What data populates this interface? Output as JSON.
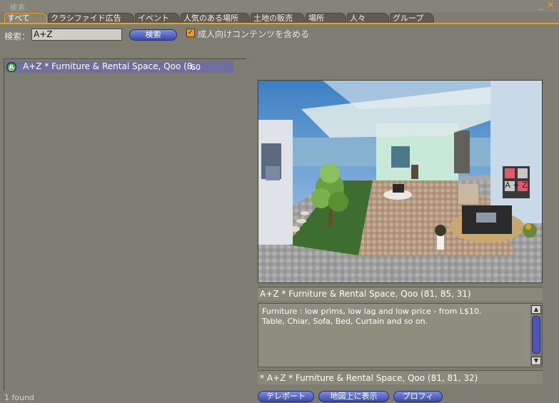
{
  "window": {
    "title": "検索",
    "minimize_glyph": "_",
    "close_glyph": "✕"
  },
  "tabs": [
    {
      "label": "すべて",
      "active": true
    },
    {
      "label": "クラシファイド広告"
    },
    {
      "label": "イベント"
    },
    {
      "label": "人気のある場所"
    },
    {
      "label": "土地の販売"
    },
    {
      "label": "場所"
    },
    {
      "label": "人々"
    },
    {
      "label": "グループ"
    }
  ],
  "search": {
    "label": "検索：",
    "value": "A+Z",
    "button_label": "検索",
    "mature_checkbox_label": "成人向けコンテンツを含める",
    "mature_checked": true,
    "check_glyph": "✓"
  },
  "results": [
    {
      "icon": "hand-icon",
      "name": "A+Z * Furniture & Rental Space, Qoo (8...",
      "traffic": "60"
    }
  ],
  "status": {
    "found_text": "1 found"
  },
  "detail": {
    "parcel_name": "A+Z * Furniture & Rental Space, Qoo (81, 85, 31)",
    "description_lines": [
      "Furniture : low prims, low lag and low price - from L$10.",
      "Table, Chiar, Sofa, Bed, Curtain and so on."
    ],
    "location": "* A+Z * Furniture & Rental Space, Qoo (81, 81, 32)",
    "scroll_up_glyph": "▲",
    "scroll_down_glyph": "▼",
    "sign_text": "A + Z"
  },
  "actions": {
    "teleport_label": "テレポート",
    "show_on_map_label": "地図上に表示",
    "profile_label": "プロフィ"
  },
  "colors": {
    "accent": "#e8a020",
    "button": "#4a58b8",
    "selected_row": "#6e6f9e",
    "panel_bg": "#7f7d72"
  }
}
